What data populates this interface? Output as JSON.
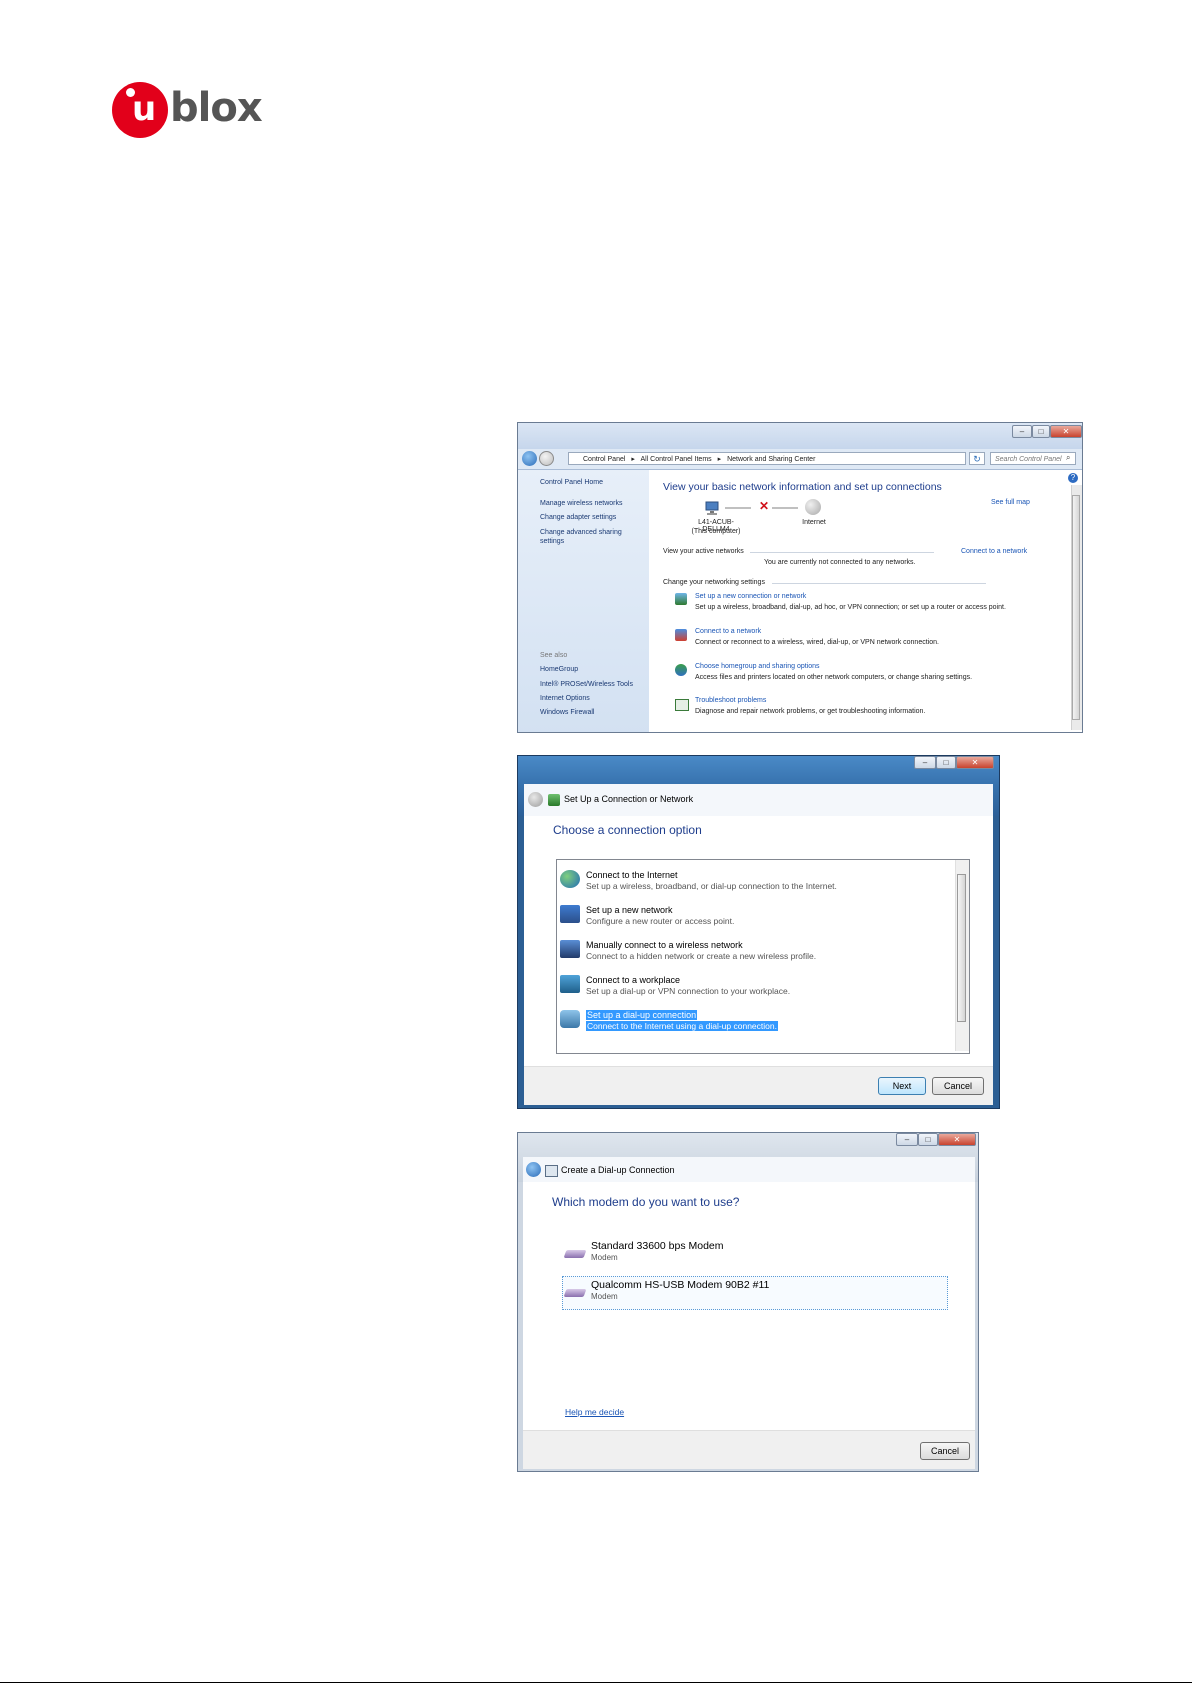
{
  "logo": {
    "u": "u",
    "text": "blox"
  },
  "window1": {
    "address": {
      "crumbs": [
        "Control Panel",
        "All Control Panel Items",
        "Network and Sharing Center"
      ],
      "search_placeholder": "Search Control Panel"
    },
    "sidebar": {
      "home": "Control Panel Home",
      "links": [
        "Manage wireless networks",
        "Change adapter settings",
        "Change advanced sharing settings"
      ],
      "see_also": "See also",
      "see_also_links": [
        "HomeGroup",
        "Intel® PROSet/Wireless Tools",
        "Internet Options",
        "Windows Firewall"
      ]
    },
    "main": {
      "heading": "View your basic network information and set up connections",
      "see_full_map": "See full map",
      "computer_name": "L41-ACUB-DELLM4",
      "computer_sub": "(This computer)",
      "internet": "Internet",
      "active_label": "View your active networks",
      "connect_link": "Connect to a network",
      "not_connected": "You are currently not connected to any networks.",
      "change_label": "Change your networking settings",
      "tasks": [
        {
          "title": "Set up a new connection or network",
          "desc": "Set up a wireless, broadband, dial-up, ad hoc, or VPN connection; or set up a router or access point."
        },
        {
          "title": "Connect to a network",
          "desc": "Connect or reconnect to a wireless, wired, dial-up, or VPN network connection."
        },
        {
          "title": "Choose homegroup and sharing options",
          "desc": "Access files and printers located on other network computers, or change sharing settings."
        },
        {
          "title": "Troubleshoot problems",
          "desc": "Diagnose and repair network problems, or get troubleshooting information."
        }
      ]
    }
  },
  "window2": {
    "title": "Set Up a Connection or Network",
    "heading": "Choose a connection option",
    "options": [
      {
        "title": "Connect to the Internet",
        "desc": "Set up a wireless, broadband, or dial-up connection to the Internet."
      },
      {
        "title": "Set up a new network",
        "desc": "Configure a new router or access point."
      },
      {
        "title": "Manually connect to a wireless network",
        "desc": "Connect to a hidden network or create a new wireless profile."
      },
      {
        "title": "Connect to a workplace",
        "desc": "Set up a dial-up or VPN connection to your workplace."
      },
      {
        "title": "Set up a dial-up connection",
        "desc": "Connect to the Internet using a dial-up connection."
      }
    ],
    "next": "Next",
    "cancel": "Cancel"
  },
  "window3": {
    "title": "Create a Dial-up Connection",
    "heading": "Which modem do you want to use?",
    "modems": [
      {
        "name": "Standard 33600 bps Modem",
        "type": "Modem"
      },
      {
        "name": "Qualcomm HS-USB Modem 90B2 #11",
        "type": "Modem"
      }
    ],
    "help": "Help me decide",
    "cancel": "Cancel"
  },
  "colors": {
    "brand_red": "#e2001a",
    "win7_link": "#1a55b5",
    "selection": "#3399ff"
  }
}
